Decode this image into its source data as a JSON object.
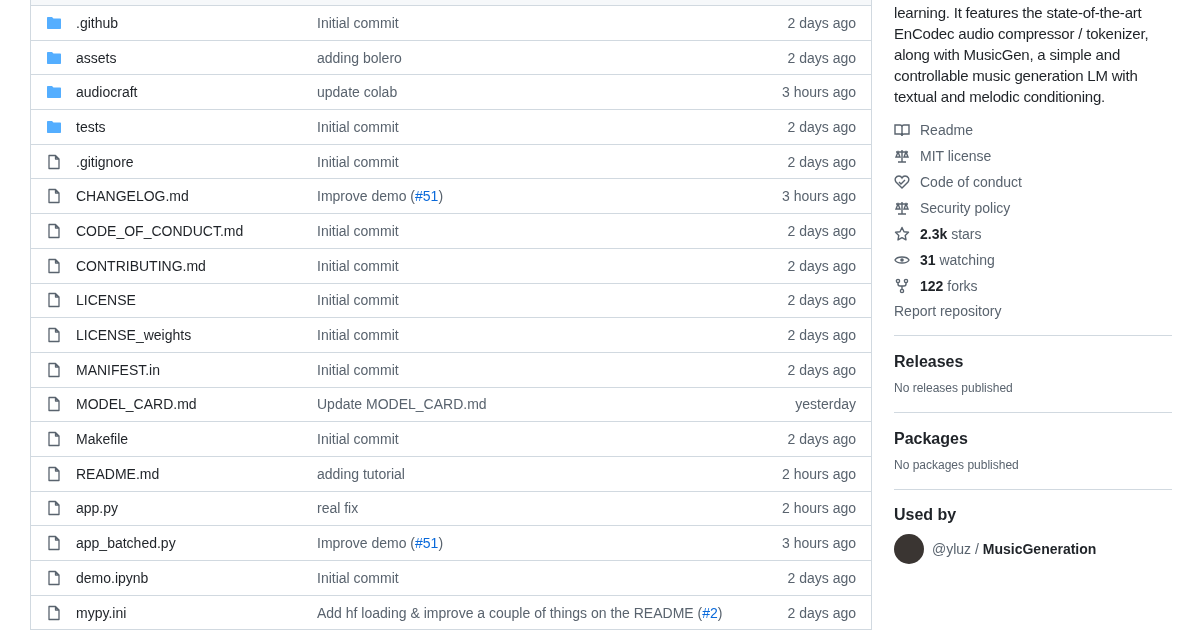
{
  "files": [
    {
      "kind": "dir",
      "name": ".github",
      "message": "Initial commit",
      "age": "2 days ago"
    },
    {
      "kind": "dir",
      "name": "assets",
      "message": "adding bolero",
      "age": "2 days ago"
    },
    {
      "kind": "dir",
      "name": "audiocraft",
      "message": "update colab",
      "age": "3 hours ago"
    },
    {
      "kind": "dir",
      "name": "tests",
      "message": "Initial commit",
      "age": "2 days ago"
    },
    {
      "kind": "file",
      "name": ".gitignore",
      "message": "Initial commit",
      "age": "2 days ago"
    },
    {
      "kind": "file",
      "name": "CHANGELOG.md",
      "message": "Improve demo (",
      "link": "#51",
      "message_end": ")",
      "age": "3 hours ago"
    },
    {
      "kind": "file",
      "name": "CODE_OF_CONDUCT.md",
      "message": "Initial commit",
      "age": "2 days ago"
    },
    {
      "kind": "file",
      "name": "CONTRIBUTING.md",
      "message": "Initial commit",
      "age": "2 days ago"
    },
    {
      "kind": "file",
      "name": "LICENSE",
      "message": "Initial commit",
      "age": "2 days ago"
    },
    {
      "kind": "file",
      "name": "LICENSE_weights",
      "message": "Initial commit",
      "age": "2 days ago"
    },
    {
      "kind": "file",
      "name": "MANIFEST.in",
      "message": "Initial commit",
      "age": "2 days ago"
    },
    {
      "kind": "file",
      "name": "MODEL_CARD.md",
      "message": "Update MODEL_CARD.md",
      "age": "yesterday"
    },
    {
      "kind": "file",
      "name": "Makefile",
      "message": "Initial commit",
      "age": "2 days ago"
    },
    {
      "kind": "file",
      "name": "README.md",
      "message": "adding tutorial",
      "age": "2 hours ago"
    },
    {
      "kind": "file",
      "name": "app.py",
      "message": "real fix",
      "age": "2 hours ago"
    },
    {
      "kind": "file",
      "name": "app_batched.py",
      "message": "Improve demo (",
      "link": "#51",
      "message_end": ")",
      "age": "3 hours ago"
    },
    {
      "kind": "file",
      "name": "demo.ipynb",
      "message": "Initial commit",
      "age": "2 days ago"
    },
    {
      "kind": "file",
      "name": "mypy.ini",
      "message": "Add hf loading & improve a couple of things on the README (",
      "link": "#2",
      "message_end": ")",
      "age": "2 days ago"
    }
  ],
  "about": {
    "description": "learning. It features the state-of-the-art EnCodec audio compressor / tokenizer, along with MusicGen, a simple and controllable music generation LM with textual and melodic conditioning.",
    "links": [
      {
        "kind": "book",
        "text": "Readme"
      },
      {
        "kind": "scale",
        "text": "MIT license"
      },
      {
        "kind": "heart",
        "text": "Code of conduct"
      },
      {
        "kind": "scale",
        "text": "Security policy"
      },
      {
        "kind": "star",
        "text": "**2.3k** stars"
      },
      {
        "kind": "eye",
        "text": "**31** watching"
      },
      {
        "kind": "fork",
        "text": "**122** forks"
      }
    ],
    "report": "Report repository"
  },
  "sections": [
    {
      "title": "Releases",
      "note": "No releases published"
    },
    {
      "title": "Packages",
      "note": "No packages published"
    }
  ],
  "used_by": {
    "title": "Used by",
    "entry": "@yluz / **MusicGeneration**"
  }
}
